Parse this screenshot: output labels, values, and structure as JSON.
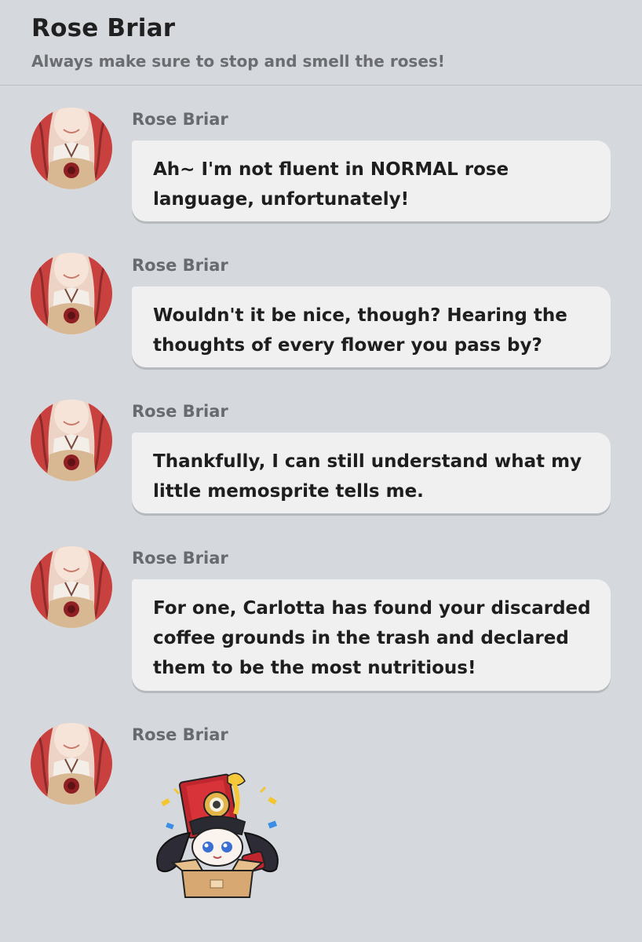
{
  "header": {
    "title": "Rose Briar",
    "subtitle": "Always make sure to stop and smell the roses!"
  },
  "messages": [
    {
      "sender": "Rose Briar",
      "lines": [
        "Ah~ I'm not fluent in NORMAL rose",
        "language, unfortunately!"
      ]
    },
    {
      "sender": "Rose Briar",
      "lines": [
        "Wouldn't it be nice, though? Hearing the",
        "thoughts of every flower you pass by?"
      ]
    },
    {
      "sender": "Rose Briar",
      "lines": [
        "Thankfully, I can still understand what my",
        "little memosprite tells me."
      ]
    },
    {
      "sender": "Rose Briar",
      "lines": [
        "For one, Carlotta has found your discarded",
        "coffee grounds in the trash and declared",
        "them to be the most nutritious!"
      ]
    },
    {
      "sender": "Rose Briar",
      "sticker": "chibi-box-sticker"
    }
  ],
  "icons": {
    "avatar": "rose-briar-avatar",
    "sticker": "chibi-character-in-box-sticker"
  },
  "colors": {
    "background": "#d5d9de",
    "bubble": "#f0f0f1",
    "sender": "#676a6e",
    "subtitle": "#6b6d70"
  }
}
